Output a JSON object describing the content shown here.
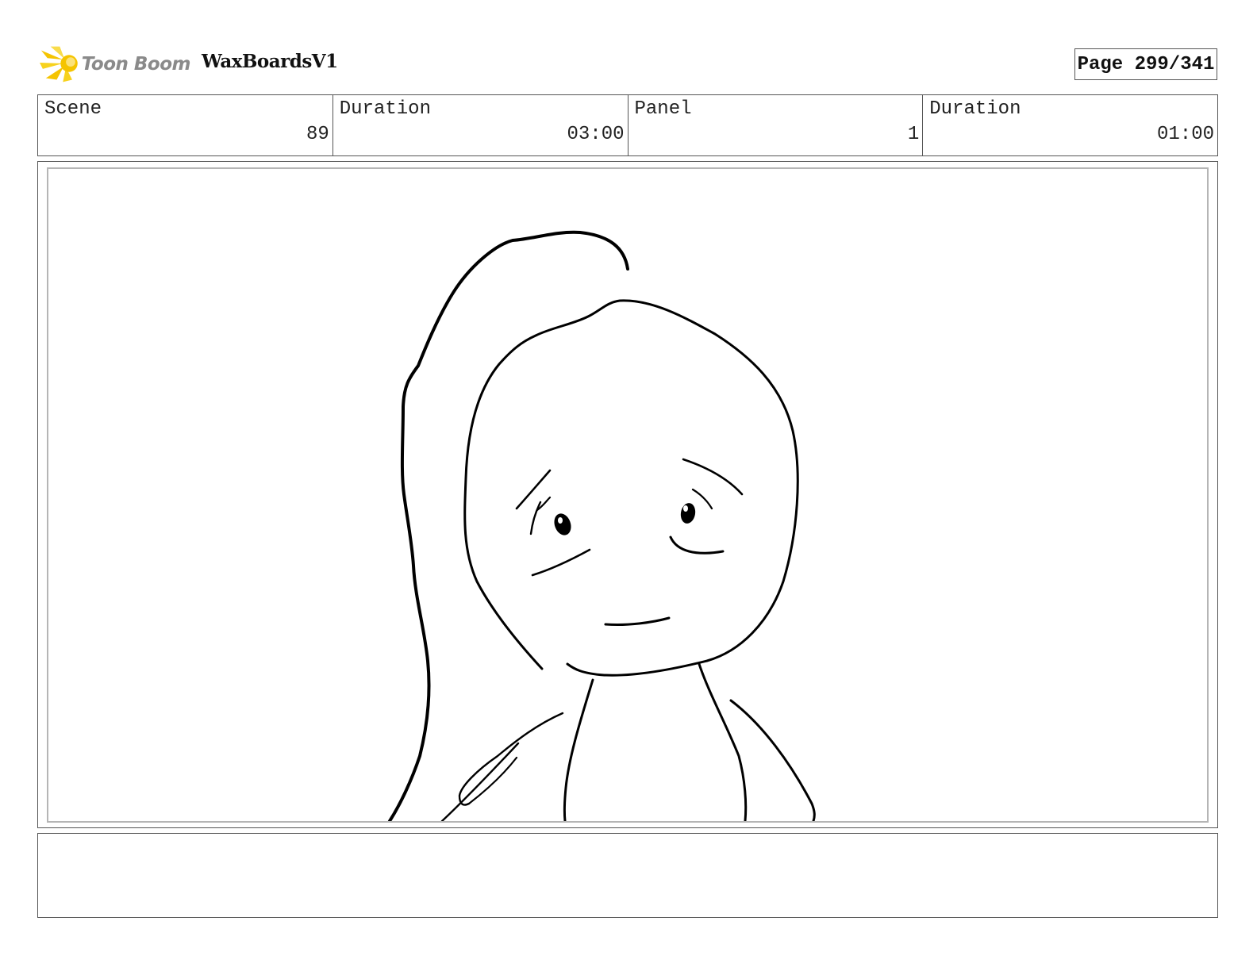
{
  "header": {
    "logo_text": "Toon Boom",
    "project_title": "WaxBoardsV1",
    "page_label": "Page 299/341"
  },
  "info": {
    "scene_label": "Scene",
    "scene_value": "89",
    "scene_duration_label": "Duration",
    "scene_duration_value": "03:00",
    "panel_label": "Panel",
    "panel_value": "1",
    "panel_duration_label": "Duration",
    "panel_duration_value": "01:00"
  },
  "notes": {
    "text": ""
  },
  "colors": {
    "logo_star": "#f5c400",
    "logo_text": "#8a8a8a",
    "border": "#555555",
    "panel_inner_border": "#b5b5b5"
  }
}
